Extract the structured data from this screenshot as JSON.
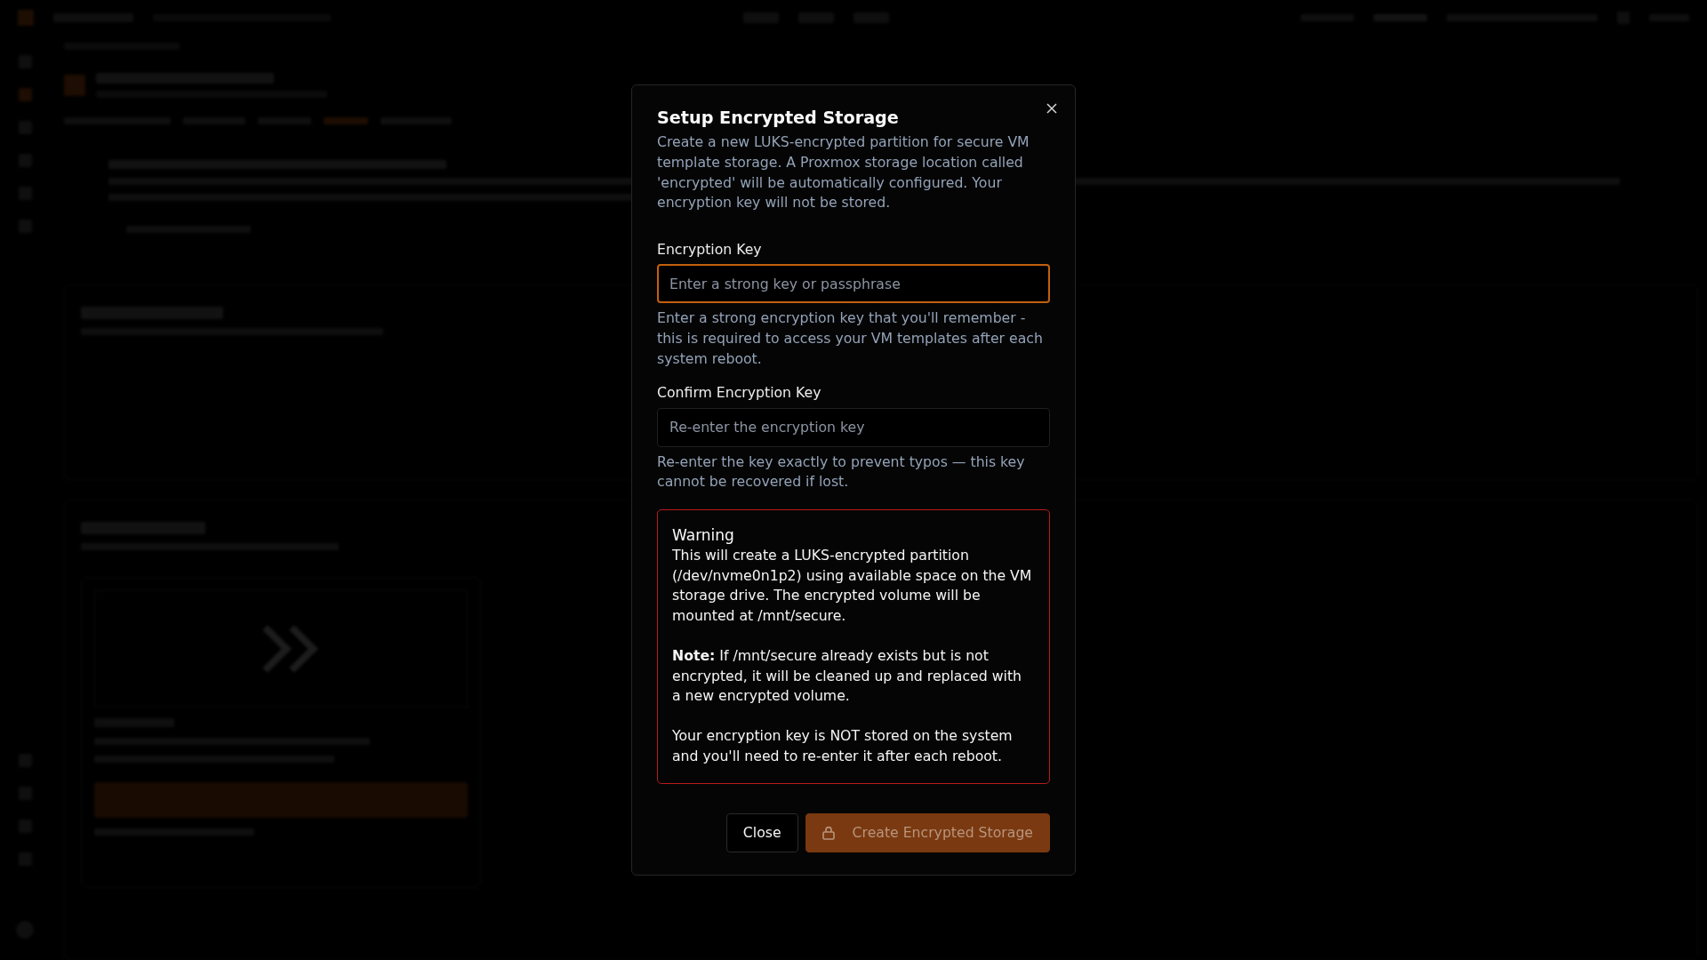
{
  "dialog": {
    "title": "Setup Encrypted Storage",
    "description": "Create a new LUKS-encrypted partition for secure VM template storage. A Proxmox storage location called 'encrypted' will be automatically configured. Your encryption key will not be stored.",
    "fields": [
      {
        "label": "Encryption Key",
        "placeholder": "Enter a strong key or passphrase",
        "focused": true,
        "help": "Enter a strong encryption key that you'll remember - this is required to access your VM templates after each system reboot."
      },
      {
        "label": "Confirm Encryption Key",
        "placeholder": "Re-enter the encryption key",
        "focused": false,
        "help": "Re-enter the key exactly to prevent typos — this key cannot be recovered if lost."
      }
    ],
    "warning": {
      "title": "Warning",
      "paragraphs": [
        "This will create a LUKS-encrypted partition (/dev/nvme0n1p2) using available space on the VM storage drive. The encrypted volume will be mounted at /mnt/secure.",
        "**Note:** If /mnt/secure already exists but is not encrypted, it will be cleaned up and replaced with a new encrypted volume.",
        "Your encryption key is NOT stored on the system and you'll need to re-enter it after each reboot."
      ]
    },
    "buttons": [
      {
        "label": "Close",
        "kind": "secondary",
        "disabled": false
      },
      {
        "label": "Create Encrypted Storage",
        "kind": "primary",
        "disabled": true
      }
    ]
  }
}
